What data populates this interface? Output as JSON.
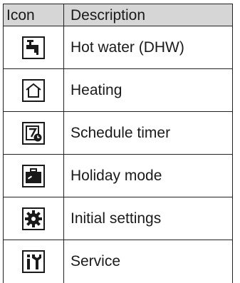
{
  "table": {
    "headers": {
      "icon": "Icon",
      "description": "Description"
    },
    "rows": [
      {
        "icon": "hot-water-tap-icon",
        "description": "Hot water (DHW)"
      },
      {
        "icon": "house-icon",
        "description": "Heating"
      },
      {
        "icon": "schedule-timer-icon",
        "description": "Schedule timer"
      },
      {
        "icon": "suitcase-icon",
        "description": "Holiday mode"
      },
      {
        "icon": "gear-icon",
        "description": "Initial settings"
      },
      {
        "icon": "tools-icon",
        "description": "Service"
      }
    ]
  }
}
